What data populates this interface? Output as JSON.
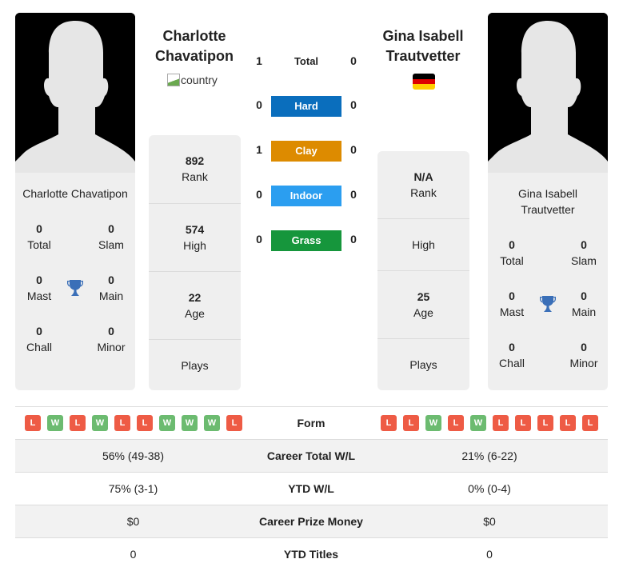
{
  "player1": {
    "name_line1": "Charlotte",
    "name_line2": "Chavatipon",
    "full_name": "Charlotte Chavatipon",
    "country_alt": "country",
    "titles": {
      "total": {
        "value": "0",
        "label": "Total"
      },
      "slam": {
        "value": "0",
        "label": "Slam"
      },
      "mast": {
        "value": "0",
        "label": "Mast"
      },
      "main": {
        "value": "0",
        "label": "Main"
      },
      "chall": {
        "value": "0",
        "label": "Chall"
      },
      "minor": {
        "value": "0",
        "label": "Minor"
      }
    },
    "stats": {
      "rank": {
        "value": "892",
        "label": "Rank"
      },
      "high": {
        "value": "574",
        "label": "High"
      },
      "age": {
        "value": "22",
        "label": "Age"
      },
      "plays": {
        "value": "",
        "label": "Plays"
      }
    },
    "form": [
      "L",
      "W",
      "L",
      "W",
      "L",
      "L",
      "W",
      "W",
      "W",
      "L"
    ],
    "career_wl": "56% (49-38)",
    "ytd_wl": "75% (3-1)",
    "prize_money": "$0",
    "ytd_titles": "0"
  },
  "player2": {
    "name_line1": "Gina Isabell",
    "name_line2": "Trautvetter",
    "full_name_line1": "Gina Isabell",
    "full_name_line2": "Trautvetter",
    "country": "Germany",
    "flag_colors": [
      "#000000",
      "#dd0000",
      "#ffce00"
    ],
    "titles": {
      "total": {
        "value": "0",
        "label": "Total"
      },
      "slam": {
        "value": "0",
        "label": "Slam"
      },
      "mast": {
        "value": "0",
        "label": "Mast"
      },
      "main": {
        "value": "0",
        "label": "Main"
      },
      "chall": {
        "value": "0",
        "label": "Chall"
      },
      "minor": {
        "value": "0",
        "label": "Minor"
      }
    },
    "stats": {
      "rank": {
        "value": "N/A",
        "label": "Rank"
      },
      "high": {
        "value": "",
        "label": "High"
      },
      "age": {
        "value": "25",
        "label": "Age"
      },
      "plays": {
        "value": "",
        "label": "Plays"
      }
    },
    "form": [
      "L",
      "L",
      "W",
      "L",
      "W",
      "L",
      "L",
      "L",
      "L",
      "L"
    ],
    "career_wl": "21% (6-22)",
    "ytd_wl": "0% (0-4)",
    "prize_money": "$0",
    "ytd_titles": "0"
  },
  "h2h": {
    "total": {
      "label": "Total",
      "p1": "1",
      "p2": "0"
    },
    "surfaces": [
      {
        "label": "Hard",
        "p1": "0",
        "p2": "0",
        "color": "#0a6ebd"
      },
      {
        "label": "Clay",
        "p1": "1",
        "p2": "0",
        "color": "#dd8b00"
      },
      {
        "label": "Indoor",
        "p1": "0",
        "p2": "0",
        "color": "#2b9ef0"
      },
      {
        "label": "Grass",
        "p1": "0",
        "p2": "0",
        "color": "#16963c"
      }
    ]
  },
  "table": {
    "form_label": "Form",
    "career_wl_label": "Career Total W/L",
    "ytd_wl_label": "YTD W/L",
    "prize_label": "Career Prize Money",
    "ytd_titles_label": "YTD Titles"
  },
  "colors": {
    "loss": "#ee5b45",
    "win": "#6cbb70",
    "trophy": "#3a6fb8",
    "card_bg": "#efefef"
  }
}
